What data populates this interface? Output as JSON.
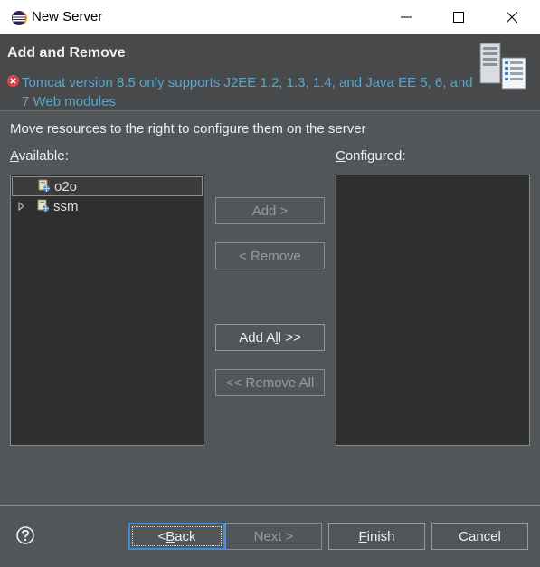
{
  "window": {
    "title": "New Server",
    "icons": {
      "app": "eclipse-icon",
      "minimize": "minimize-icon",
      "maximize": "maximize-icon",
      "close": "close-icon"
    }
  },
  "header": {
    "title": "Add and Remove",
    "error_icon": "error-icon",
    "error_message": "Tomcat version 8.5 only supports J2EE 1.2, 1.3, 1.4, and Java EE 5, 6, and 7 Web modules",
    "banner_icon": "server-icon"
  },
  "main": {
    "instruction": "Move resources to the right to configure them on the server",
    "available_label": {
      "mnemonic": "A",
      "rest": "vailable:"
    },
    "configured_label": {
      "mnemonic": "C",
      "rest": "onfigured:"
    },
    "available_items": [
      {
        "name": "o2o",
        "selected": true,
        "expandable": false,
        "icon": "web-project-icon"
      },
      {
        "name": "ssm",
        "selected": false,
        "expandable": true,
        "icon": "web-project-icon"
      }
    ],
    "configured_items": []
  },
  "buttons": {
    "add": "Add >",
    "remove": "< Remove",
    "add_all": {
      "before": "Add A",
      "mnemonic": "l",
      "after": "l >>"
    },
    "remove_all": "<< Remove All",
    "back": {
      "before": "< ",
      "mnemonic": "B",
      "after": "ack"
    },
    "next": "Next >",
    "finish": {
      "mnemonic": "F",
      "after": "inish"
    },
    "cancel": "Cancel"
  },
  "help_icon": "help-icon",
  "colors": {
    "dialog_bg": "#515658",
    "header_bg": "#48494b",
    "list_bg": "#2f2f2f",
    "error_text": "#5aa6c8",
    "focus": "#3d8ee0"
  }
}
